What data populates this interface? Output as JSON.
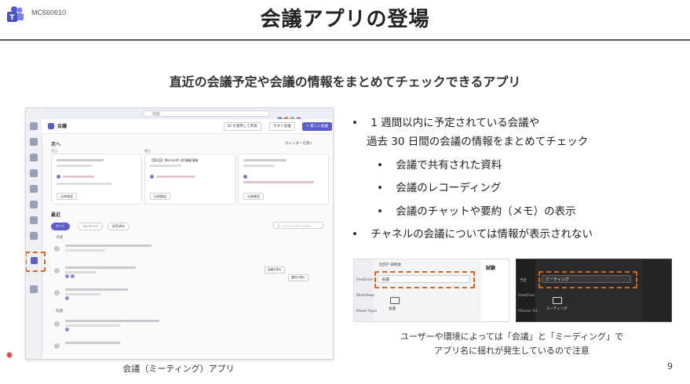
{
  "header": {
    "doc_id": "MC660610",
    "title": "会議アプリの登場"
  },
  "subtitle": "直近の会議予定や会議の情報をまとめてチェックできるアプリ",
  "main_screenshot": {
    "search_placeholder": "検索",
    "app_title": "会議",
    "buttons": {
      "join_by_id": "ID を使用して参加",
      "meet_now": "今すぐ会議",
      "new_meeting": "+ 新しい会議"
    },
    "next_section": "次へ",
    "open_calendar": "カレンダーを開く",
    "day_today": "今日",
    "day_tomorrow": "明日",
    "card_2_title": "【第2回】Microsoft 365最新情報",
    "card_btn": "出席確認",
    "recent_section": "最近",
    "filters": [
      "すべて",
      "コンテンツ",
      "録音済み"
    ],
    "keyword_filter": "キーワードでフィルター",
    "group_1": "今週",
    "group_2": "先週",
    "tooltip": "会議を表示",
    "recap_button": "要約の表示",
    "caption": "会議（ミーティング）アプリ",
    "accent_color": "#5b5fc7",
    "highlight_color": "#d9641e"
  },
  "bullets": [
    {
      "marker": "•",
      "lines": [
        "1 週間以内に予定されている会議や",
        "過去 30 日間の会議の情報をまとめてチェック"
      ]
    },
    {
      "marker": "•",
      "text": "会議で共有された資料",
      "sub": true
    },
    {
      "marker": "•",
      "text": "会議のレコーディング",
      "sub": true
    },
    {
      "marker": "•",
      "text": "会議のチャットや要約（メモ）の表示",
      "sub": true
    },
    {
      "marker": "•",
      "text": "チャネルの会議については情報が表示されない"
    }
  ],
  "small_screenshots": {
    "a": {
      "team_label": "社内IT 研修会",
      "search_text": "会議",
      "app_label": "会議",
      "tab_label": "試験",
      "rail": [
        "OneDrive",
        "Workflows",
        "Power Apps"
      ]
    },
    "b": {
      "search_text": "ミーティング",
      "app_label": "ミーティング",
      "rail": [
        "予定",
        "OneDrive",
        "Planner Ed.."
      ]
    }
  },
  "caption2_lines": [
    "ユーザーや環境によっては「会議」と「ミーディング」で",
    "アプリ名に揺れが発生しているので注意"
  ],
  "page_number": "9"
}
